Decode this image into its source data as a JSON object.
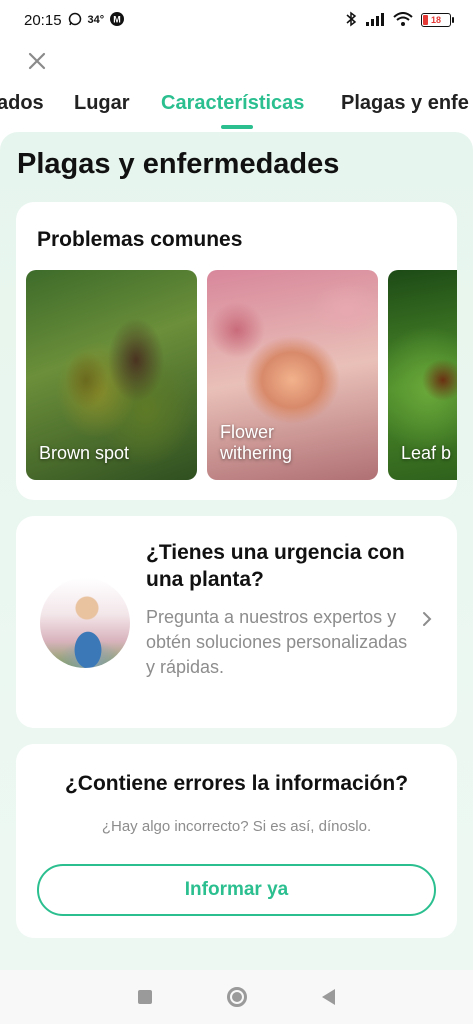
{
  "status_bar": {
    "time": "20:15",
    "temperature": "34°",
    "battery_level": "18",
    "battery_color": "#e53935"
  },
  "header": {
    "close_icon": "close-icon"
  },
  "tabs": [
    {
      "label": "ados"
    },
    {
      "label": "Lugar"
    },
    {
      "label": "Características",
      "active": true
    },
    {
      "label": "Plagas y enfe"
    }
  ],
  "accent_color": "#2bbf8f",
  "section": {
    "title": "Plagas y enfermedades"
  },
  "problems": {
    "title": "Problemas comunes",
    "items": [
      {
        "label": "Brown spot"
      },
      {
        "label": "Flower withering"
      },
      {
        "label": "Leaf b"
      }
    ]
  },
  "urgent": {
    "title": "¿Tienes una urgencia con una planta?",
    "description": "Pregunta a nuestros expertos y obtén soluciones personalizadas y rápidas."
  },
  "feedback": {
    "title": "¿Contiene errores la información?",
    "subtitle": "¿Hay algo incorrecto? Si es así, díno­slo.",
    "button": "Informar ya"
  }
}
